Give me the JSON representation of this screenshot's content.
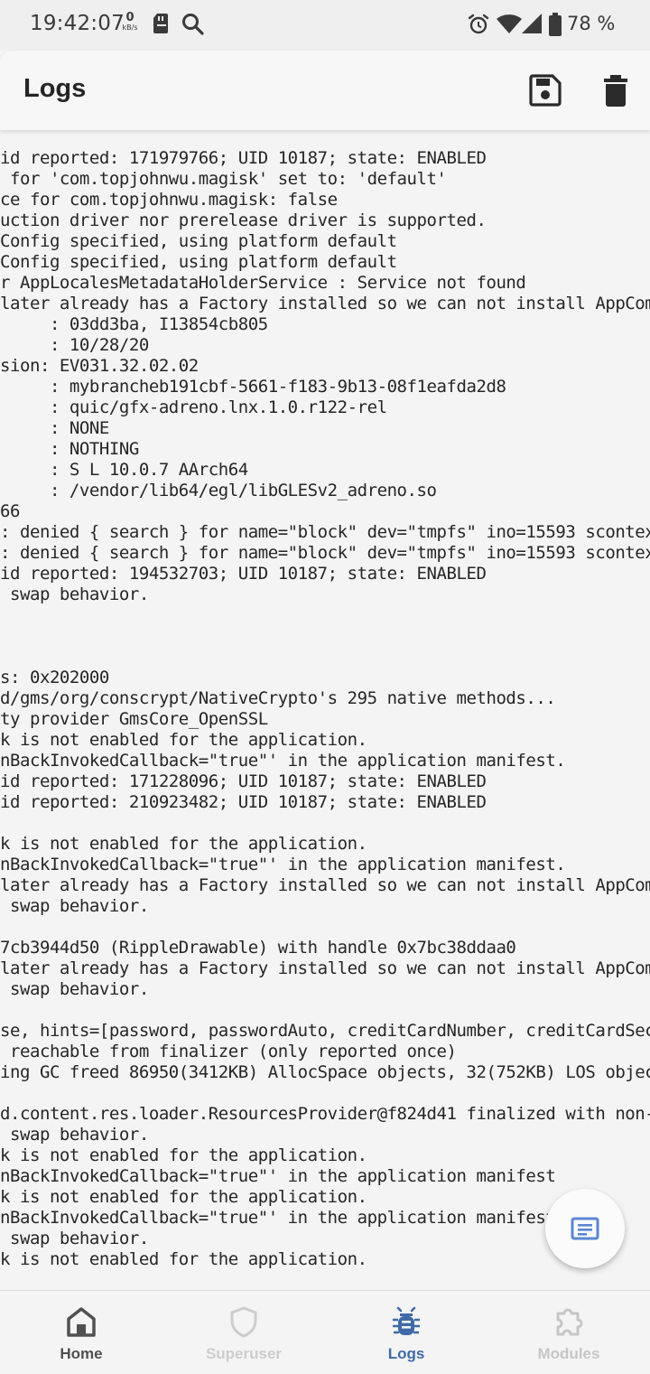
{
  "status_bar": {
    "time": "19:42:07",
    "net_speed_value": "0",
    "net_speed_unit": "kB/s",
    "battery_percent": "78 %"
  },
  "app_bar": {
    "title": "Logs",
    "save_icon": "save-icon",
    "delete_icon": "trash-icon"
  },
  "log_lines": [
    "id reported: 171979766; UID 10187; state: ENABLED",
    " for 'com.topjohnwu.magisk' set to: 'default'",
    "ce for com.topjohnwu.magisk: false",
    "uction driver nor prerelease driver is supported.",
    "Config specified, using platform default",
    "Config specified, using platform default",
    "r AppLocalesMetadataHolderService : Service not found",
    "later already has a Factory installed so we can not install AppCom",
    "     : 03dd3ba, I13854cb805",
    "     : 10/28/20",
    "sion: EV031.32.02.02",
    "     : mybrancheb191cbf-5661-f183-9b13-08f1eafda2d8",
    "     : quic/gfx-adreno.lnx.1.0.r122-rel",
    "     : NONE",
    "     : NOTHING",
    "     : S L 10.0.7 AArch64",
    "     : /vendor/lib64/egl/libGLESv2_adreno.so",
    "66",
    ": denied { search } for name=\"block\" dev=\"tmpfs\" ino=15593 scontex",
    ": denied { search } for name=\"block\" dev=\"tmpfs\" ino=15593 scontex",
    "id reported: 194532703; UID 10187; state: ENABLED",
    " swap behavior.",
    "",
    "",
    "",
    "s: 0x202000",
    "d/gms/org/conscrypt/NativeCrypto's 295 native methods...",
    "ty provider GmsCore_OpenSSL",
    "k is not enabled for the application.",
    "nBackInvokedCallback=\"true\"' in the application manifest.",
    "id reported: 171228096; UID 10187; state: ENABLED",
    "id reported: 210923482; UID 10187; state: ENABLED",
    "",
    "k is not enabled for the application.",
    "nBackInvokedCallback=\"true\"' in the application manifest.",
    "later already has a Factory installed so we can not install AppCom",
    " swap behavior.",
    "",
    "7cb3944d50 (RippleDrawable) with handle 0x7bc38ddaa0",
    "later already has a Factory installed so we can not install AppCom",
    " swap behavior.",
    "",
    "se, hints=[password, passwordAuto, creditCardNumber, creditCardSec",
    " reachable from finalizer (only reported once)",
    "ing GC freed 86950(3412KB) AllocSpace objects, 32(752KB) LOS objec",
    "",
    "d.content.res.loader.ResourcesProvider@f824d41 finalized with non-",
    " swap behavior.",
    "k is not enabled for the application.",
    "nBackInvokedCallback=\"true\"' in the application manifest",
    "k is not enabled for the application.",
    "nBackInvokedCallback=\"true\"' in the application manifest",
    " swap behavior.",
    "k is not enabled for the application."
  ],
  "fab": {
    "icon": "log-file-icon"
  },
  "bottom_nav": {
    "items": [
      {
        "label": "Home",
        "icon": "home-icon",
        "color": "#505050"
      },
      {
        "label": "Superuser",
        "icon": "shield-icon",
        "color": "#cdcdcd"
      },
      {
        "label": "Logs",
        "icon": "bug-icon",
        "color": "#3f6aa6",
        "active": true
      },
      {
        "label": "Modules",
        "icon": "puzzle-icon",
        "color": "#c6c6c6"
      }
    ]
  },
  "colors": {
    "accent": "#3f6aa6",
    "fab_icon": "#5b86d4",
    "text": "#262626"
  }
}
